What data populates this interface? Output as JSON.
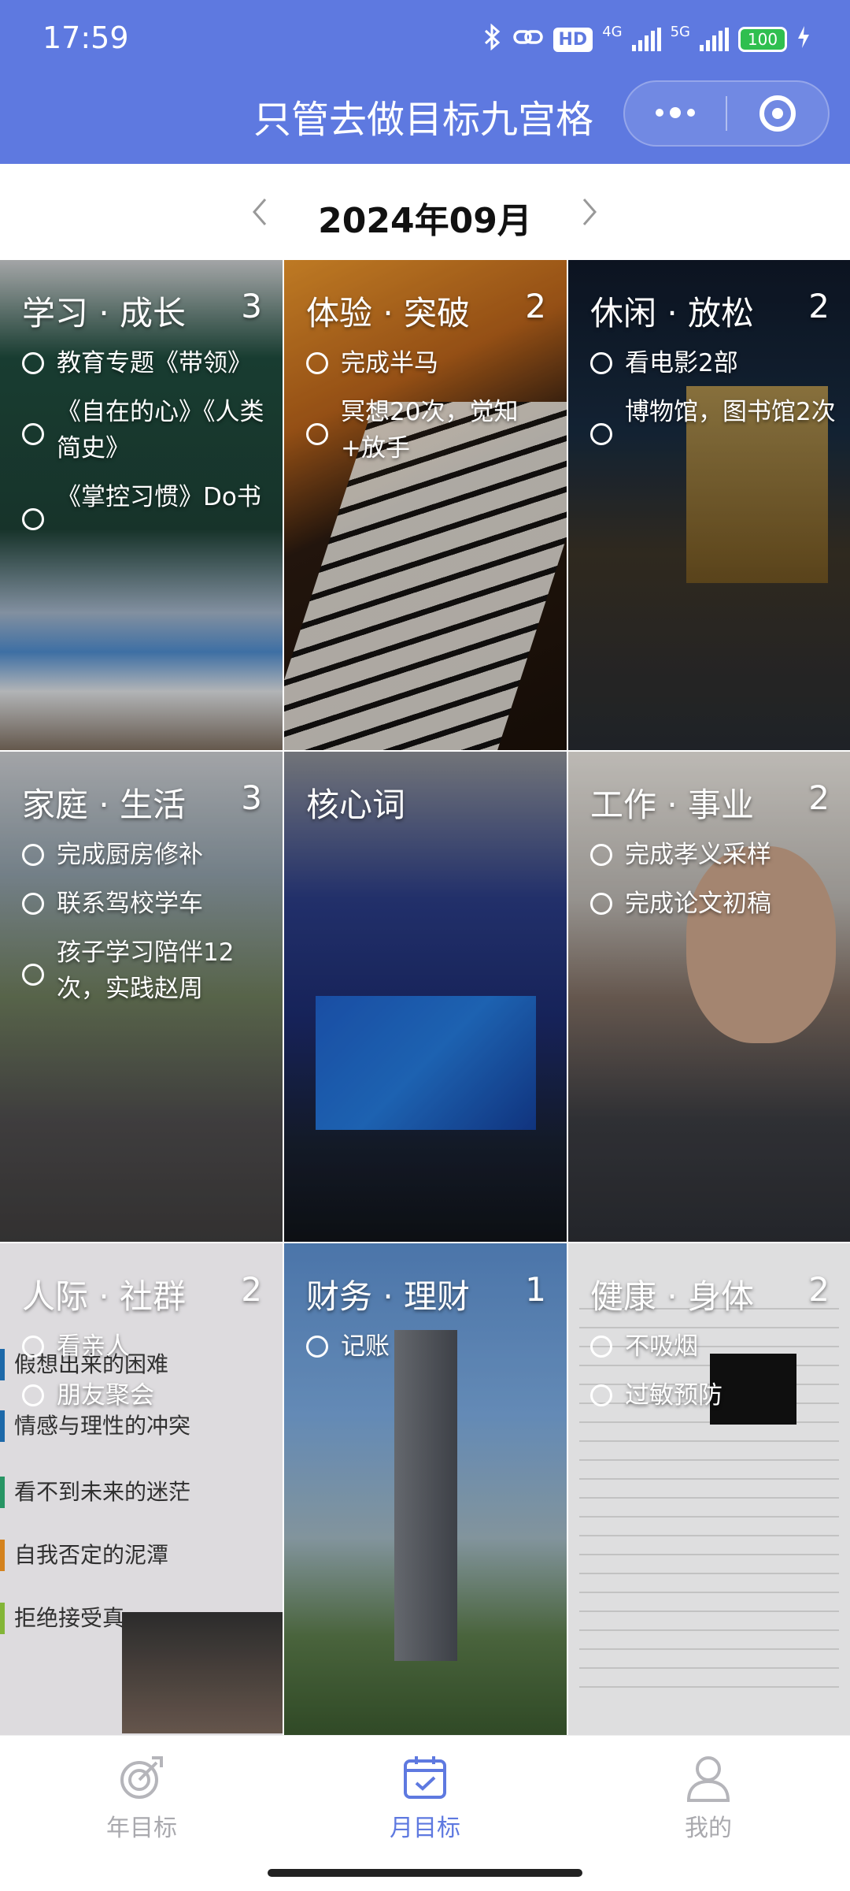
{
  "status_bar": {
    "time": "17:59",
    "hd": "HD",
    "net1": "4G",
    "net2": "5G",
    "battery": "100"
  },
  "header": {
    "title": "只管去做目标九宫格"
  },
  "month_switch": {
    "label": "2024年09月"
  },
  "cells": [
    {
      "title": "学习 · 成长",
      "count": "3",
      "items": [
        "教育专题《带领》",
        "《自在的心》《人类简史》",
        "《掌控习惯》Do书"
      ]
    },
    {
      "title": "体验 · 突破",
      "count": "2",
      "items": [
        "完成半马",
        "冥想20次，觉知+放手"
      ]
    },
    {
      "title": "休闲 · 放松",
      "count": "2",
      "items": [
        "看电影2部",
        "博物馆，图书馆2次"
      ]
    },
    {
      "title": "家庭 · 生活",
      "count": "3",
      "items": [
        "完成厨房修补",
        "联系驾校学车",
        "孩子学习陪伴12次，实践赵周"
      ]
    },
    {
      "title": "核心词",
      "count": "",
      "items": []
    },
    {
      "title": "工作 · 事业",
      "count": "2",
      "items": [
        "完成孝义采样",
        "完成论文初稿"
      ]
    },
    {
      "title": "人际 · 社群",
      "count": "2",
      "items": [
        "看亲人",
        "朋友聚会"
      ]
    },
    {
      "title": "财务 · 理财",
      "count": "1",
      "items": [
        "记账"
      ]
    },
    {
      "title": "健康 · 身体",
      "count": "2",
      "items": [
        "不吸烟",
        "过敏预防"
      ]
    }
  ],
  "notes_background": [
    "假想出来的困难",
    "情感与理性的冲突",
    "看不到未来的迷茫",
    "自我否定的泥潭",
    "拒绝接受真"
  ],
  "tabbar": {
    "year_label": "年目标",
    "month_label": "月目标",
    "me_label": "我的"
  },
  "colors": {
    "primary": "#5e79e0",
    "tab_inactive": "#a9a9ae"
  }
}
